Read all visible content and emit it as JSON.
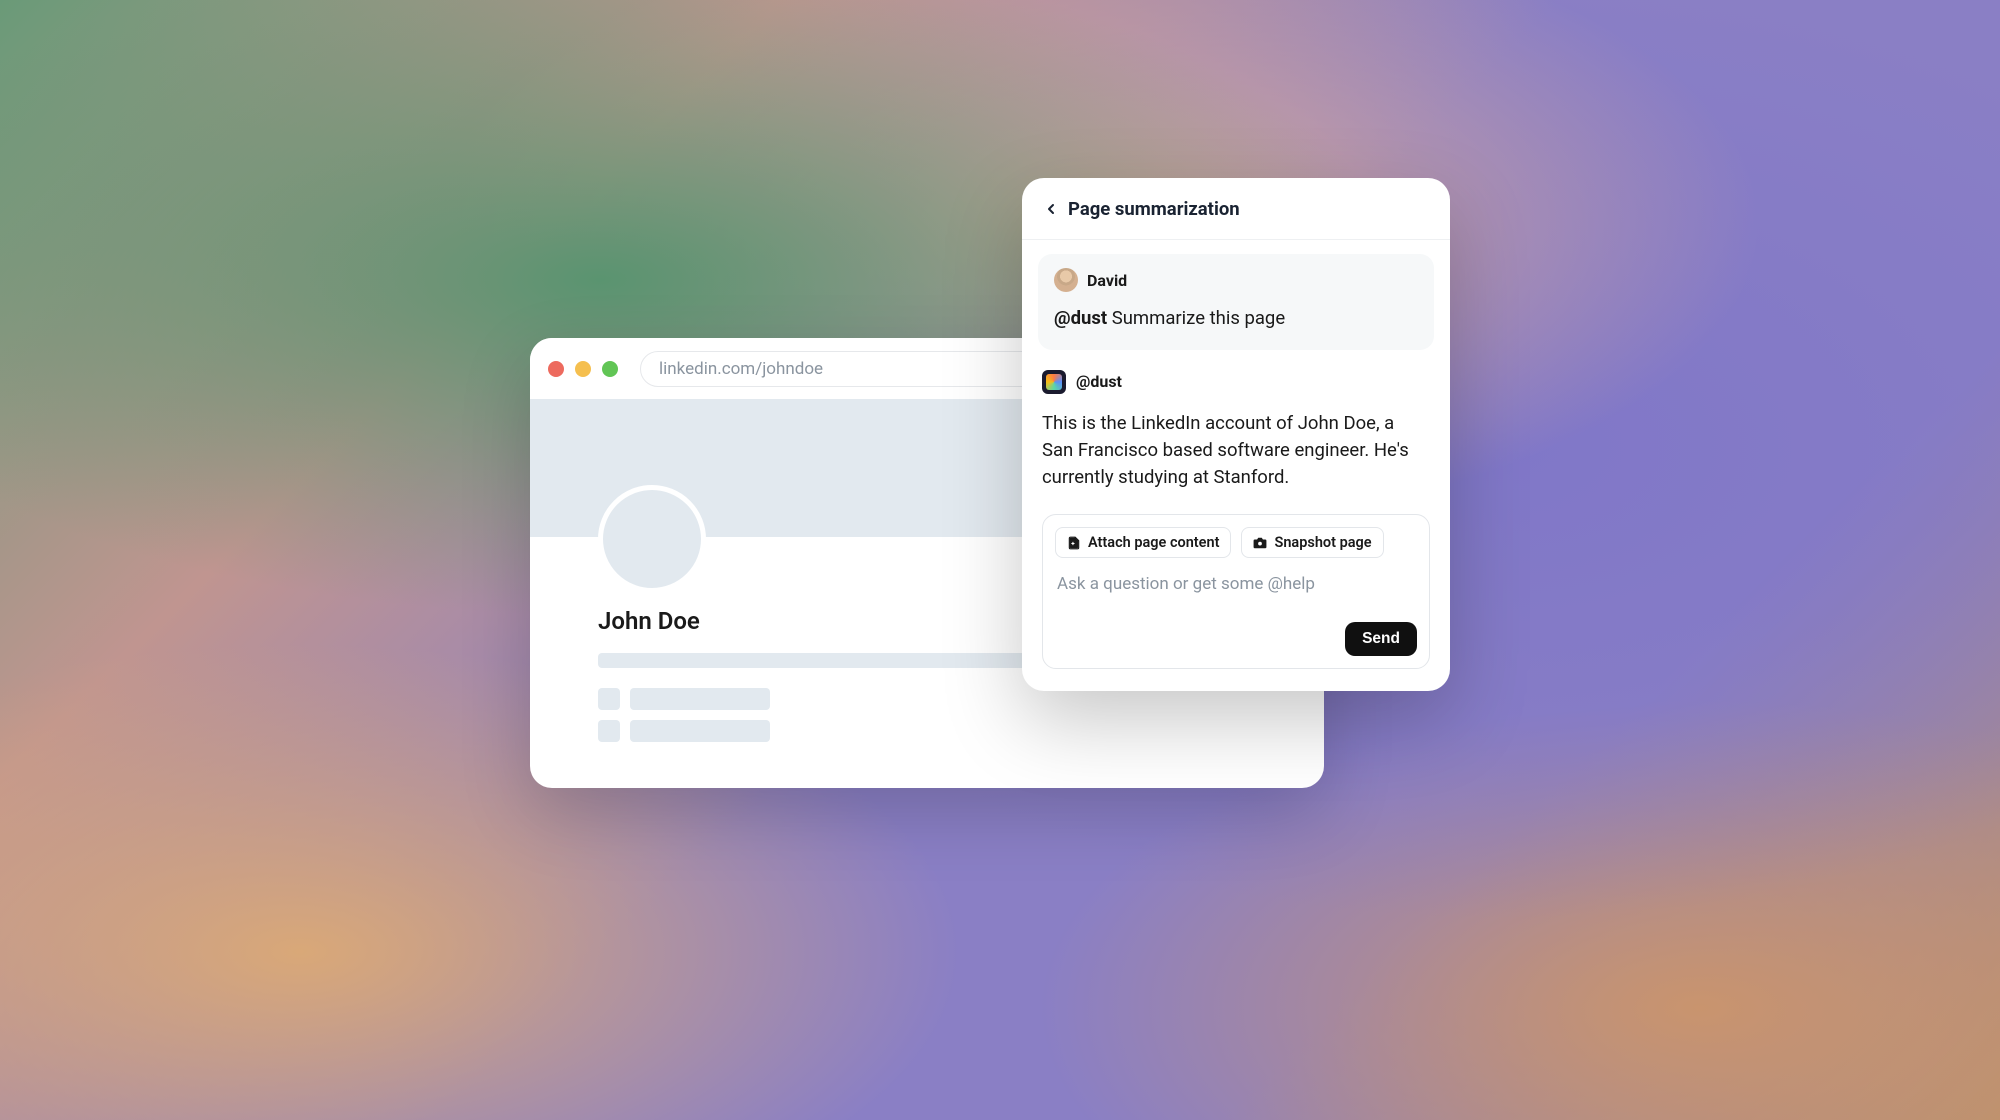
{
  "browser": {
    "url": "linkedin.com/johndoe",
    "profile_name": "John Doe"
  },
  "panel": {
    "title": "Page summarization",
    "user_message": {
      "author": "David",
      "mention": "@dust",
      "text": " Summarize this page"
    },
    "bot_message": {
      "author": "@dust",
      "text": "This is the LinkedIn account of John Doe, a San Francisco based software engineer. He's currently studying at Stanford."
    },
    "composer": {
      "attach_label": "Attach page content",
      "snapshot_label": "Snapshot page",
      "placeholder": "Ask a question or get some @help",
      "send_label": "Send"
    }
  }
}
